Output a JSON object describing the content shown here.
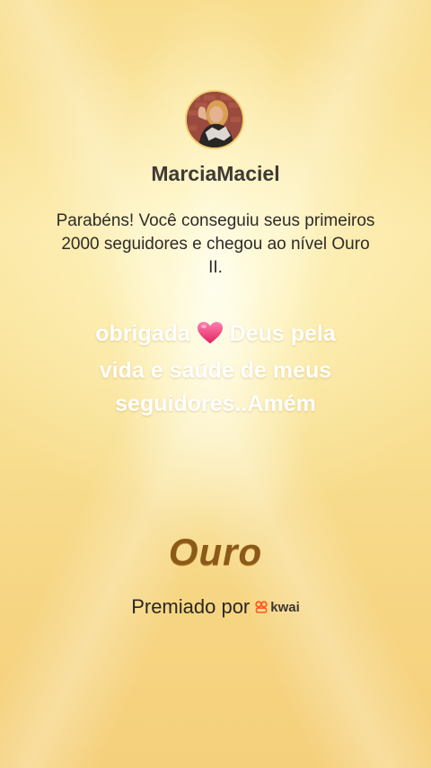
{
  "user": {
    "name": "MarciaMaciel",
    "avatar": "profile-photo"
  },
  "message": "Parabéns! Você conseguiu seus primeiros 2000 seguidores e chegou ao nível Ouro II.",
  "caption": {
    "before_heart": "obrigada ",
    "after_heart": " Deus pela vida e saúde de meus seguidores..Amém",
    "heart_icon": "pink-heart-icon"
  },
  "level": "Ouro",
  "award": {
    "prefix": "Premiado por",
    "brand": "kwai",
    "brand_icon": "kwai-logo-icon",
    "brand_color": "#ff5a1f"
  },
  "colors": {
    "background": "#f8dd8e",
    "level_text": "#8b5a18",
    "caption_text": "#ffffff"
  }
}
